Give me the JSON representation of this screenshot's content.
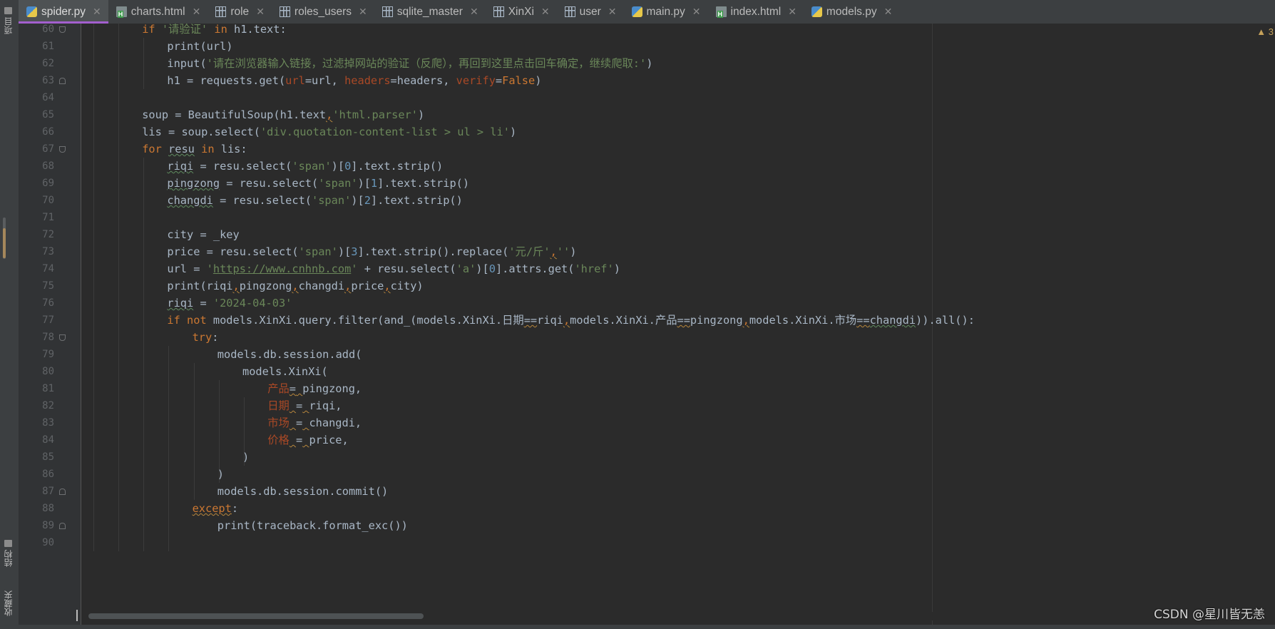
{
  "left_toolbar": {
    "project_label": "项目",
    "structure_label": "结构",
    "favorites_label": "收藏夹"
  },
  "tabs": [
    {
      "label": "spider.py",
      "icon": "python-file-icon",
      "active": true
    },
    {
      "label": "charts.html",
      "icon": "html-file-icon",
      "active": false
    },
    {
      "label": "role",
      "icon": "table-icon",
      "active": false
    },
    {
      "label": "roles_users",
      "icon": "table-icon",
      "active": false
    },
    {
      "label": "sqlite_master",
      "icon": "table-icon",
      "active": false
    },
    {
      "label": "XinXi",
      "icon": "table-icon",
      "active": false
    },
    {
      "label": "user",
      "icon": "table-icon",
      "active": false
    },
    {
      "label": "main.py",
      "icon": "python-file-icon",
      "active": false
    },
    {
      "label": "index.html",
      "icon": "html-file-icon",
      "active": false
    },
    {
      "label": "models.py",
      "icon": "python-file-icon",
      "active": false
    }
  ],
  "editor": {
    "inspection_count": "3",
    "lines": [
      {
        "n": "60",
        "indent": 3,
        "html": "<span class='kw'>if</span> <span class='str'>'请验证'</span> <span class='kw'>in</span> h1.text:"
      },
      {
        "n": "61",
        "indent": 4,
        "html": "print(url)"
      },
      {
        "n": "62",
        "indent": 4,
        "html": "input(<span class='str'>'请在浏览器输入链接，过滤掉网站的验证（反爬），再回到这里点击回车确定，继续爬取:'</span>)"
      },
      {
        "n": "63",
        "indent": 4,
        "html": "h1 = requests.get(<span class='param'>url</span>=url, <span class='param'>headers</span>=headers, <span class='param'>verify</span>=<span class='kw'>False</span>)"
      },
      {
        "n": "64",
        "indent": 0,
        "html": ""
      },
      {
        "n": "65",
        "indent": 3,
        "html": "soup = BeautifulSoup(h1.text<span class='kw warn'>,</span><span class='str'>'html.parser'</span>)"
      },
      {
        "n": "66",
        "indent": 3,
        "html": "lis = soup.select(<span class='str'>'div.quotation-content-list &gt; ul &gt; li'</span>)"
      },
      {
        "n": "67",
        "indent": 3,
        "html": "<span class='kw'>for</span> <span class='typo'>resu</span> <span class='kw'>in</span> lis:"
      },
      {
        "n": "68",
        "indent": 4,
        "html": "<span class='typo'>riqi</span> = resu.select(<span class='str'>'span'</span>)[<span class='num'>0</span>].text.strip()"
      },
      {
        "n": "69",
        "indent": 4,
        "html": "<span class='typo'>pingzong</span> = resu.select(<span class='str'>'span'</span>)[<span class='num'>1</span>].text.strip()"
      },
      {
        "n": "70",
        "indent": 4,
        "html": "<span class='typo'>changdi</span> = resu.select(<span class='str'>'span'</span>)[<span class='num'>2</span>].text.strip()"
      },
      {
        "n": "71",
        "indent": 0,
        "html": ""
      },
      {
        "n": "72",
        "indent": 4,
        "html": "city = _key"
      },
      {
        "n": "73",
        "indent": 4,
        "html": "price = resu.select(<span class='str'>'span'</span>)[<span class='num'>3</span>].text.strip().replace(<span class='str'>'元/斤'</span><span class='kw warn'>,</span><span class='str'>''</span>)"
      },
      {
        "n": "74",
        "indent": 4,
        "html": "url = <span class='str'>'<span class='uline'>https://www.cnhnb.com</span>'</span> + resu.select(<span class='str'>'a'</span>)[<span class='num'>0</span>].attrs.get(<span class='str'>'href'</span>)"
      },
      {
        "n": "75",
        "indent": 4,
        "html": "print(riqi<span class='kw warn'>,</span>pingzong<span class='kw warn'>,</span>changdi<span class='kw warn'>,</span>price<span class='kw warn'>,</span>city)"
      },
      {
        "n": "76",
        "indent": 4,
        "html": "<span class='typo'>riqi</span> = <span class='str'>'2024-04-03'</span>"
      },
      {
        "n": "77",
        "indent": 4,
        "html": "<span class='kw'>if not</span> models.XinXi.query.filter(and_(models.XinXi.日期<span class='warn'>==</span>riqi<span class='kw warn'>,</span>models.XinXi.产品<span class='warn'>==</span>pingzong<span class='kw warn'>,</span>models.XinXi.市场<span class='warn'>==</span><span class='typo'>changdi</span>)).all():"
      },
      {
        "n": "78",
        "indent": 5,
        "html": "<span class='kw'>try</span>:"
      },
      {
        "n": "79",
        "indent": 6,
        "html": "models.db.session.add("
      },
      {
        "n": "80",
        "indent": 7,
        "html": "models.XinXi("
      },
      {
        "n": "81",
        "indent": 8,
        "html": "<span class='param'>产品</span><span class='warn'>=</span><span class='warn'> </span>pingzong,"
      },
      {
        "n": "82",
        "indent": 8,
        "html": "<span class='param'>日期</span><span class='warn'> </span>=<span class='warn'> </span>riqi,"
      },
      {
        "n": "83",
        "indent": 8,
        "html": "<span class='param'>市场</span><span class='warn'> </span>=<span class='warn'> </span>changdi,"
      },
      {
        "n": "84",
        "indent": 8,
        "html": "<span class='param'>价格</span><span class='warn'> </span>=<span class='warn'> </span>price,"
      },
      {
        "n": "85",
        "indent": 7,
        "html": ")"
      },
      {
        "n": "86",
        "indent": 6,
        "html": ")"
      },
      {
        "n": "87",
        "indent": 6,
        "html": "models.db.session.commit()"
      },
      {
        "n": "88",
        "indent": 5,
        "html": "<span class='kw warn'>except</span>:"
      },
      {
        "n": "89",
        "indent": 6,
        "html": "print(traceback.format_exc())"
      },
      {
        "n": "90",
        "indent": 0,
        "html": ""
      }
    ]
  },
  "watermark": "CSDN @星川皆无恙"
}
